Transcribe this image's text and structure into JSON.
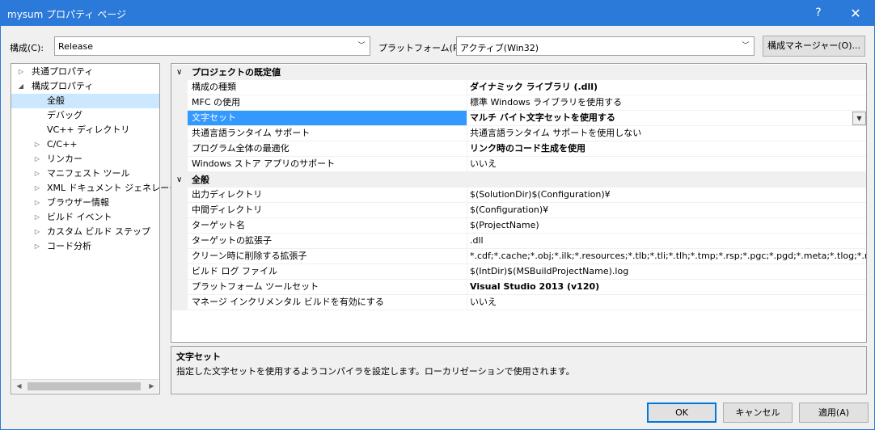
{
  "window": {
    "title": "mysum プロパティ ページ",
    "help_label": "?",
    "close_label": "✕"
  },
  "config_bar": {
    "config_label": "構成(C):",
    "config_value": "Release",
    "platform_label": "プラットフォーム(P):",
    "platform_value": "アクティブ(Win32)",
    "config_manager_label": "構成マネージャー(O)..."
  },
  "tree": {
    "items": [
      {
        "label": "共通プロパティ",
        "expander": "▷"
      },
      {
        "label": "構成プロパティ",
        "expander": "◢"
      },
      {
        "label": "全般",
        "expander": ""
      },
      {
        "label": "デバッグ",
        "expander": ""
      },
      {
        "label": "VC++ ディレクトリ",
        "expander": ""
      },
      {
        "label": "C/C++",
        "expander": "▷"
      },
      {
        "label": "リンカー",
        "expander": "▷"
      },
      {
        "label": "マニフェスト ツール",
        "expander": "▷"
      },
      {
        "label": "XML ドキュメント ジェネレーター",
        "expander": "▷"
      },
      {
        "label": "ブラウザー情報",
        "expander": "▷"
      },
      {
        "label": "ビルド イベント",
        "expander": "▷"
      },
      {
        "label": "カスタム ビルド ステップ",
        "expander": "▷"
      },
      {
        "label": "コード分析",
        "expander": "▷"
      }
    ],
    "selected": "全般"
  },
  "grid": {
    "categories": [
      {
        "title": "プロジェクトの既定値",
        "rows": [
          {
            "name": "構成の種類",
            "value": "ダイナミック ライブラリ (.dll)",
            "bold": true
          },
          {
            "name": "MFC の使用",
            "value": "標準 Windows ライブラリを使用する",
            "bold": false
          },
          {
            "name": "文字セット",
            "value": "マルチ バイト文字セットを使用する",
            "bold": true
          },
          {
            "name": "共通言語ランタイム サポート",
            "value": "共通言語ランタイム サポートを使用しない",
            "bold": false
          },
          {
            "name": "プログラム全体の最適化",
            "value": "リンク時のコード生成を使用",
            "bold": true
          },
          {
            "name": "Windows ストア アプリのサポート",
            "value": "いいえ",
            "bold": false
          }
        ]
      },
      {
        "title": "全般",
        "rows": [
          {
            "name": "出力ディレクトリ",
            "value": "$(SolutionDir)$(Configuration)¥",
            "bold": false
          },
          {
            "name": "中間ディレクトリ",
            "value": "$(Configuration)¥",
            "bold": false
          },
          {
            "name": "ターゲット名",
            "value": "$(ProjectName)",
            "bold": false
          },
          {
            "name": "ターゲットの拡張子",
            "value": ".dll",
            "bold": false
          },
          {
            "name": "クリーン時に削除する拡張子",
            "value": "*.cdf;*.cache;*.obj;*.ilk;*.resources;*.tlb;*.tli;*.tlh;*.tmp;*.rsp;*.pgc;*.pgd;*.meta;*.tlog;*.manifest",
            "bold": false
          },
          {
            "name": "ビルド ログ ファイル",
            "value": "$(IntDir)$(MSBuildProjectName).log",
            "bold": false
          },
          {
            "name": "プラットフォーム ツールセット",
            "value": "Visual Studio 2013 (v120)",
            "bold": true
          },
          {
            "name": "マネージ インクリメンタル ビルドを有効にする",
            "value": "いいえ",
            "bold": false
          }
        ]
      }
    ],
    "selected_row": "文字セット"
  },
  "description": {
    "title": "文字セット",
    "text": "指定した文字セットを使用するようコンパイラを設定します。ローカリゼーションで使用されます。"
  },
  "buttons": {
    "ok": "OK",
    "cancel": "キャンセル",
    "apply": "適用(A)"
  },
  "icons": {
    "combo_arrow": "﹀",
    "dropdown_arrow": "▼",
    "category_chevron": "∨",
    "scroll_left": "◀",
    "scroll_right": "▶"
  }
}
